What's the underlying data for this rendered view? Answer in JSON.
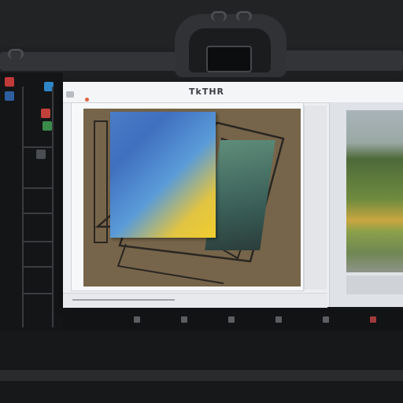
{
  "window": {
    "title": "TkTHR"
  },
  "preview": {
    "caption": ""
  },
  "colors": {
    "background": "#1f2022",
    "canvas": "#76654a",
    "window": "#eceef1",
    "accent": "#e0643c"
  },
  "icons": {
    "tools": [
      "move-icon",
      "brush-icon",
      "eraser-icon",
      "color-picker-icon",
      "layers-icon",
      "zoom-icon"
    ],
    "bottom": [
      "play-icon",
      "settings-icon",
      "grid-icon",
      "crop-icon",
      "rotate-icon",
      "export-icon"
    ]
  }
}
